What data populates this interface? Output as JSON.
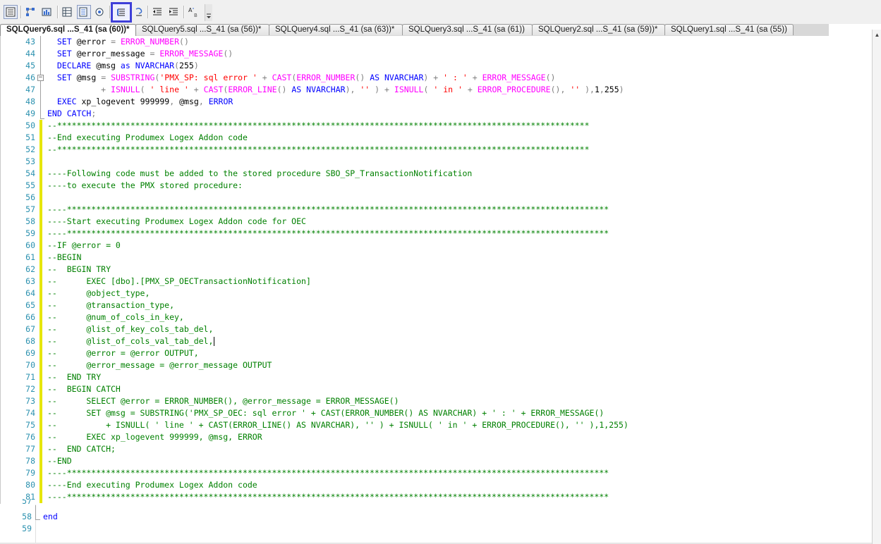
{
  "toolbar": {
    "buttons": [
      {
        "icon": "results-to-text-icon"
      },
      {
        "icon": "include-plan-icon"
      },
      {
        "icon": "client-stats-icon"
      },
      {
        "icon": "results-to-grid-icon"
      },
      {
        "icon": "results-to-file-icon"
      },
      {
        "icon": "query-options-icon"
      },
      {
        "icon": "comment-lines-icon"
      },
      {
        "icon": "uncomment-lines-icon"
      },
      {
        "icon": "decrease-indent-icon"
      },
      {
        "icon": "increase-indent-icon"
      },
      {
        "icon": "specify-template-values-icon"
      }
    ]
  },
  "tabs": [
    {
      "label": "SQLQuery6.sql ...S_41 (sa (60))*",
      "active": true
    },
    {
      "label": "SQLQuery5.sql ...S_41 (sa (56))*",
      "active": false
    },
    {
      "label": "SQLQuery4.sql ...S_41 (sa (63))*",
      "active": false
    },
    {
      "label": "SQLQuery3.sql ...S_41 (sa (61))",
      "active": false
    },
    {
      "label": "SQLQuery2.sql ...S_41 (sa (59))*",
      "active": false
    },
    {
      "label": "SQLQuery1.sql ...S_41 (sa (55))",
      "active": false
    }
  ],
  "editor": {
    "lines": [
      {
        "n": "43",
        "text": "  SET @error = ERROR_NUMBER()"
      },
      {
        "n": "44",
        "text": "  SET @error_message = ERROR_MESSAGE()"
      },
      {
        "n": "45",
        "text": "  DECLARE @msg as NVARCHAR(255)"
      },
      {
        "n": "46",
        "text": "  SET @msg = SUBSTRING('PMX_SP: sql error ' + CAST(ERROR_NUMBER() AS NVARCHAR) + ' : ' + ERROR_MESSAGE()"
      },
      {
        "n": "47",
        "text": "           + ISNULL( ' line ' + CAST(ERROR_LINE() AS NVARCHAR), '' ) + ISNULL( ' in ' + ERROR_PROCEDURE(), '' ),1,255)"
      },
      {
        "n": "48",
        "text": "  EXEC xp_logevent 999999, @msg, ERROR"
      },
      {
        "n": "49",
        "text": "END CATCH;"
      },
      {
        "n": "50",
        "text": "--*************************************************************************************************************"
      },
      {
        "n": "51",
        "text": "--End executing Produmex Logex Addon code"
      },
      {
        "n": "52",
        "text": "--*************************************************************************************************************"
      },
      {
        "n": "53",
        "text": ""
      },
      {
        "n": "54",
        "text": "----Following code must be added to the stored procedure SBO_SP_TransactionNotification"
      },
      {
        "n": "55",
        "text": "----to execute the PMX stored procedure:"
      },
      {
        "n": "56",
        "text": ""
      },
      {
        "n": "57",
        "text": "----***************************************************************************************************************"
      },
      {
        "n": "58",
        "text": "----Start executing Produmex Logex Addon code for OEC"
      },
      {
        "n": "59",
        "text": "----***************************************************************************************************************"
      },
      {
        "n": "60",
        "text": "--IF @error = 0"
      },
      {
        "n": "61",
        "text": "--BEGIN"
      },
      {
        "n": "62",
        "text": "--  BEGIN TRY"
      },
      {
        "n": "63",
        "text": "--      EXEC [dbo].[PMX_SP_OECTransactionNotification]"
      },
      {
        "n": "64",
        "text": "--      @object_type,"
      },
      {
        "n": "65",
        "text": "--      @transaction_type,"
      },
      {
        "n": "66",
        "text": "--      @num_of_cols_in_key,"
      },
      {
        "n": "67",
        "text": "--      @list_of_key_cols_tab_del,"
      },
      {
        "n": "68",
        "text": "--      @list_of_cols_val_tab_del,"
      },
      {
        "n": "69",
        "text": "--      @error = @error OUTPUT,"
      },
      {
        "n": "70",
        "text": "--      @error_message = @error_message OUTPUT"
      },
      {
        "n": "71",
        "text": "--  END TRY"
      },
      {
        "n": "72",
        "text": "--  BEGIN CATCH"
      },
      {
        "n": "73",
        "text": "--      SELECT @error = ERROR_NUMBER(), @error_message = ERROR_MESSAGE()"
      },
      {
        "n": "74",
        "text": "--      SET @msg = SUBSTRING('PMX_SP_OEC: sql error ' + CAST(ERROR_NUMBER() AS NVARCHAR) + ' : ' + ERROR_MESSAGE()"
      },
      {
        "n": "75",
        "text": "--          + ISNULL( ' line ' + CAST(ERROR_LINE() AS NVARCHAR), '' ) + ISNULL( ' in ' + ERROR_PROCEDURE(), '' ),1,255)"
      },
      {
        "n": "76",
        "text": "--      EXEC xp_logevent 999999, @msg, ERROR"
      },
      {
        "n": "77",
        "text": "--  END CATCH;"
      },
      {
        "n": "78",
        "text": "--END"
      },
      {
        "n": "79",
        "text": "----***************************************************************************************************************"
      },
      {
        "n": "80",
        "text": "----End executing Produmex Logex Addon code"
      },
      {
        "n": "81",
        "text": "----***************************************************************************************************************"
      }
    ]
  },
  "lower_pane": {
    "partial_line_number": "57",
    "lines": [
      {
        "n": "58",
        "text": "end"
      },
      {
        "n": "59",
        "text": ""
      }
    ]
  },
  "colors": {
    "keyword": "#0000ff",
    "function": "#ff00ff",
    "string": "#ff0000",
    "comment": "#008000",
    "line_number": "#2b91af",
    "change_marker": "#e6e600",
    "highlight_border": "#3f3fd8"
  }
}
